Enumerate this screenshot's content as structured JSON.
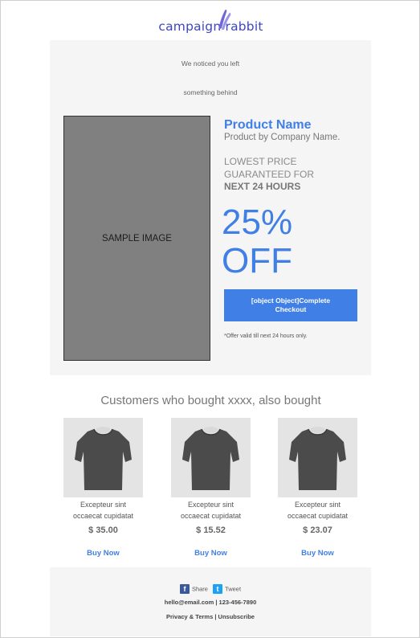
{
  "brand": {
    "logo_text": "campaign rabbit"
  },
  "hero": {
    "notice_line1": "We noticed you left",
    "notice_line2": "something behind",
    "sample_image_label": "SAMPLE IMAGE",
    "product_name": "Product Name",
    "product_company": "Product by Company Name.",
    "lowest_line1": "LOWEST PRICE",
    "lowest_line2": "GUARANTEED FOR",
    "next_24": "NEXT 24 HOURS",
    "discount_line1": "25%",
    "discount_line2": "OFF",
    "checkout_label": "[object Object]Complete Checkout",
    "offer_note": "*Offer valid till next 24 hours only."
  },
  "recommendations": {
    "title": "Customers who bought xxxx, also bought",
    "products": [
      {
        "desc1": "Excepteur sint",
        "desc2": "occaecat cupidatat",
        "price": "$ 35.00",
        "buy_label": "Buy Now"
      },
      {
        "desc1": "Excepteur sint",
        "desc2": "occaecat cupidatat",
        "price": "$ 15.52",
        "buy_label": "Buy Now"
      },
      {
        "desc1": "Excepteur sint",
        "desc2": "occaecat cupidatat",
        "price": "$ 23.07",
        "buy_label": "Buy Now"
      }
    ]
  },
  "footer": {
    "share_label": "Share",
    "tweet_label": "Tweet",
    "email": "hello@email.com",
    "phone": "123-456-7890",
    "privacy_label": "Privacy & Terms",
    "unsubscribe_label": "Unsubscribe"
  },
  "colors": {
    "accent": "#3f7fe6",
    "logo": "#3d47b8",
    "panel_bg": "#f5f5f5",
    "sample_bg": "#808080",
    "facebook": "#3b5998",
    "twitter": "#1da1f2"
  },
  "icons": [
    "rabbit-logo-icon",
    "facebook-icon",
    "twitter-icon",
    "tshirt-image"
  ]
}
